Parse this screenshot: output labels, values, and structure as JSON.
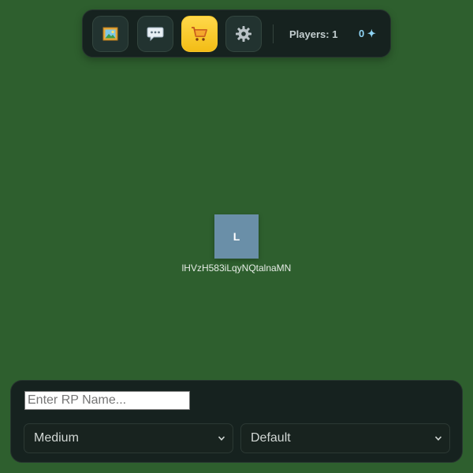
{
  "toolbar": {
    "buttons": [
      {
        "icon": "framed-picture-icon",
        "active": false
      },
      {
        "icon": "speech-bubble-icon",
        "active": false
      },
      {
        "icon": "shopping-cart-icon",
        "active": true
      },
      {
        "icon": "gear-icon",
        "active": false
      }
    ],
    "players_label": "Players: 1",
    "sparks_label": "0 ✦",
    "active_color": "#f6c62a"
  },
  "game": {
    "background_color": "#2e5f2e",
    "player": {
      "initial": "L",
      "name": "lHVzH583iLqyNQtalnaMN",
      "color": "#6a8fa8"
    }
  },
  "panel": {
    "rp_name_placeholder": "Enter RP Name...",
    "rp_name_value": "",
    "size_select": {
      "selected": "Medium"
    },
    "style_select": {
      "selected": "Default"
    }
  }
}
